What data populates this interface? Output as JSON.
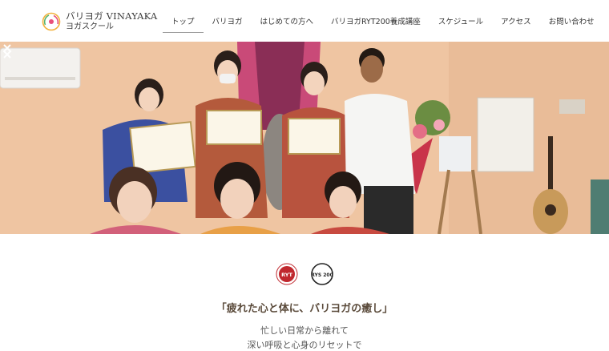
{
  "brand": {
    "name_line1": "バリヨガ VINAYAKA",
    "name_line2": "ヨガスクール"
  },
  "nav": {
    "items": [
      "トップ",
      "バリヨガ",
      "はじめての方へ",
      "バリヨガRYT200養成講座",
      "スケジュール",
      "アクセス",
      "お問い合わせ"
    ],
    "active_index": 0
  },
  "hero": {
    "icons": {
      "prev": "chevron-left-icon",
      "next": "chevron-right-icon"
    }
  },
  "badges": {
    "first_text": "RYT",
    "second_text": "RYS 200"
  },
  "intro": {
    "tagline": "「疲れた心と体に、バリヨガの癒し」",
    "line1": "忙しい日常から離れて",
    "line2": "深い呼吸と心身のリセットで"
  },
  "colors": {
    "accent": "#e8507a",
    "badge_red": "#c0282e",
    "text_dark": "#333333"
  }
}
